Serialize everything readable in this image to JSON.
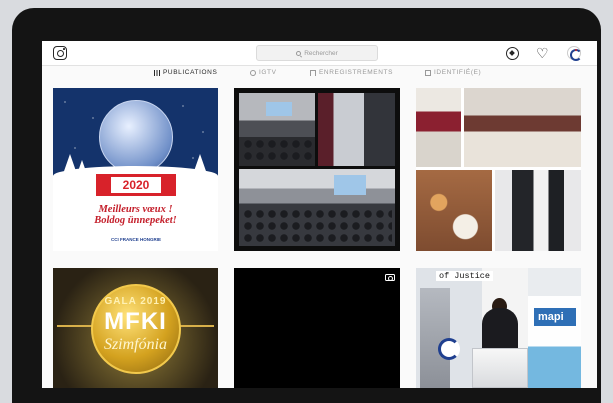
{
  "search": {
    "placeholder": "Rechercher"
  },
  "tabs": [
    {
      "label": "PUBLICATIONS",
      "active": true
    },
    {
      "label": "IGTV",
      "active": false
    },
    {
      "label": "ENREGISTREMENTS",
      "active": false
    },
    {
      "label": "IDENTIFIÉ(E)",
      "active": false
    }
  ],
  "posts": {
    "christmas": {
      "year": "2020",
      "line1": "Meilleurs vœux !",
      "line2": "Boldog ünnepeket!",
      "brand": "CCI FRANCE HONGRIE"
    },
    "gala": {
      "line1": "GALA 2019",
      "line2": "MFKI",
      "line3": "Szimfónia"
    },
    "speaker": {
      "caption": "of Justice",
      "sign": "mapi"
    }
  },
  "icons": [
    "instagram-icon",
    "search-icon",
    "explore-compass-icon",
    "heart-icon",
    "profile-avatar-icon",
    "grid-icon",
    "igtv-icon",
    "bookmark-icon",
    "tagged-icon",
    "video-camera-icon"
  ],
  "colors": {
    "accent_red": "#d8222a",
    "navy": "#14336b",
    "brand_blue": "#1f3f8f"
  }
}
